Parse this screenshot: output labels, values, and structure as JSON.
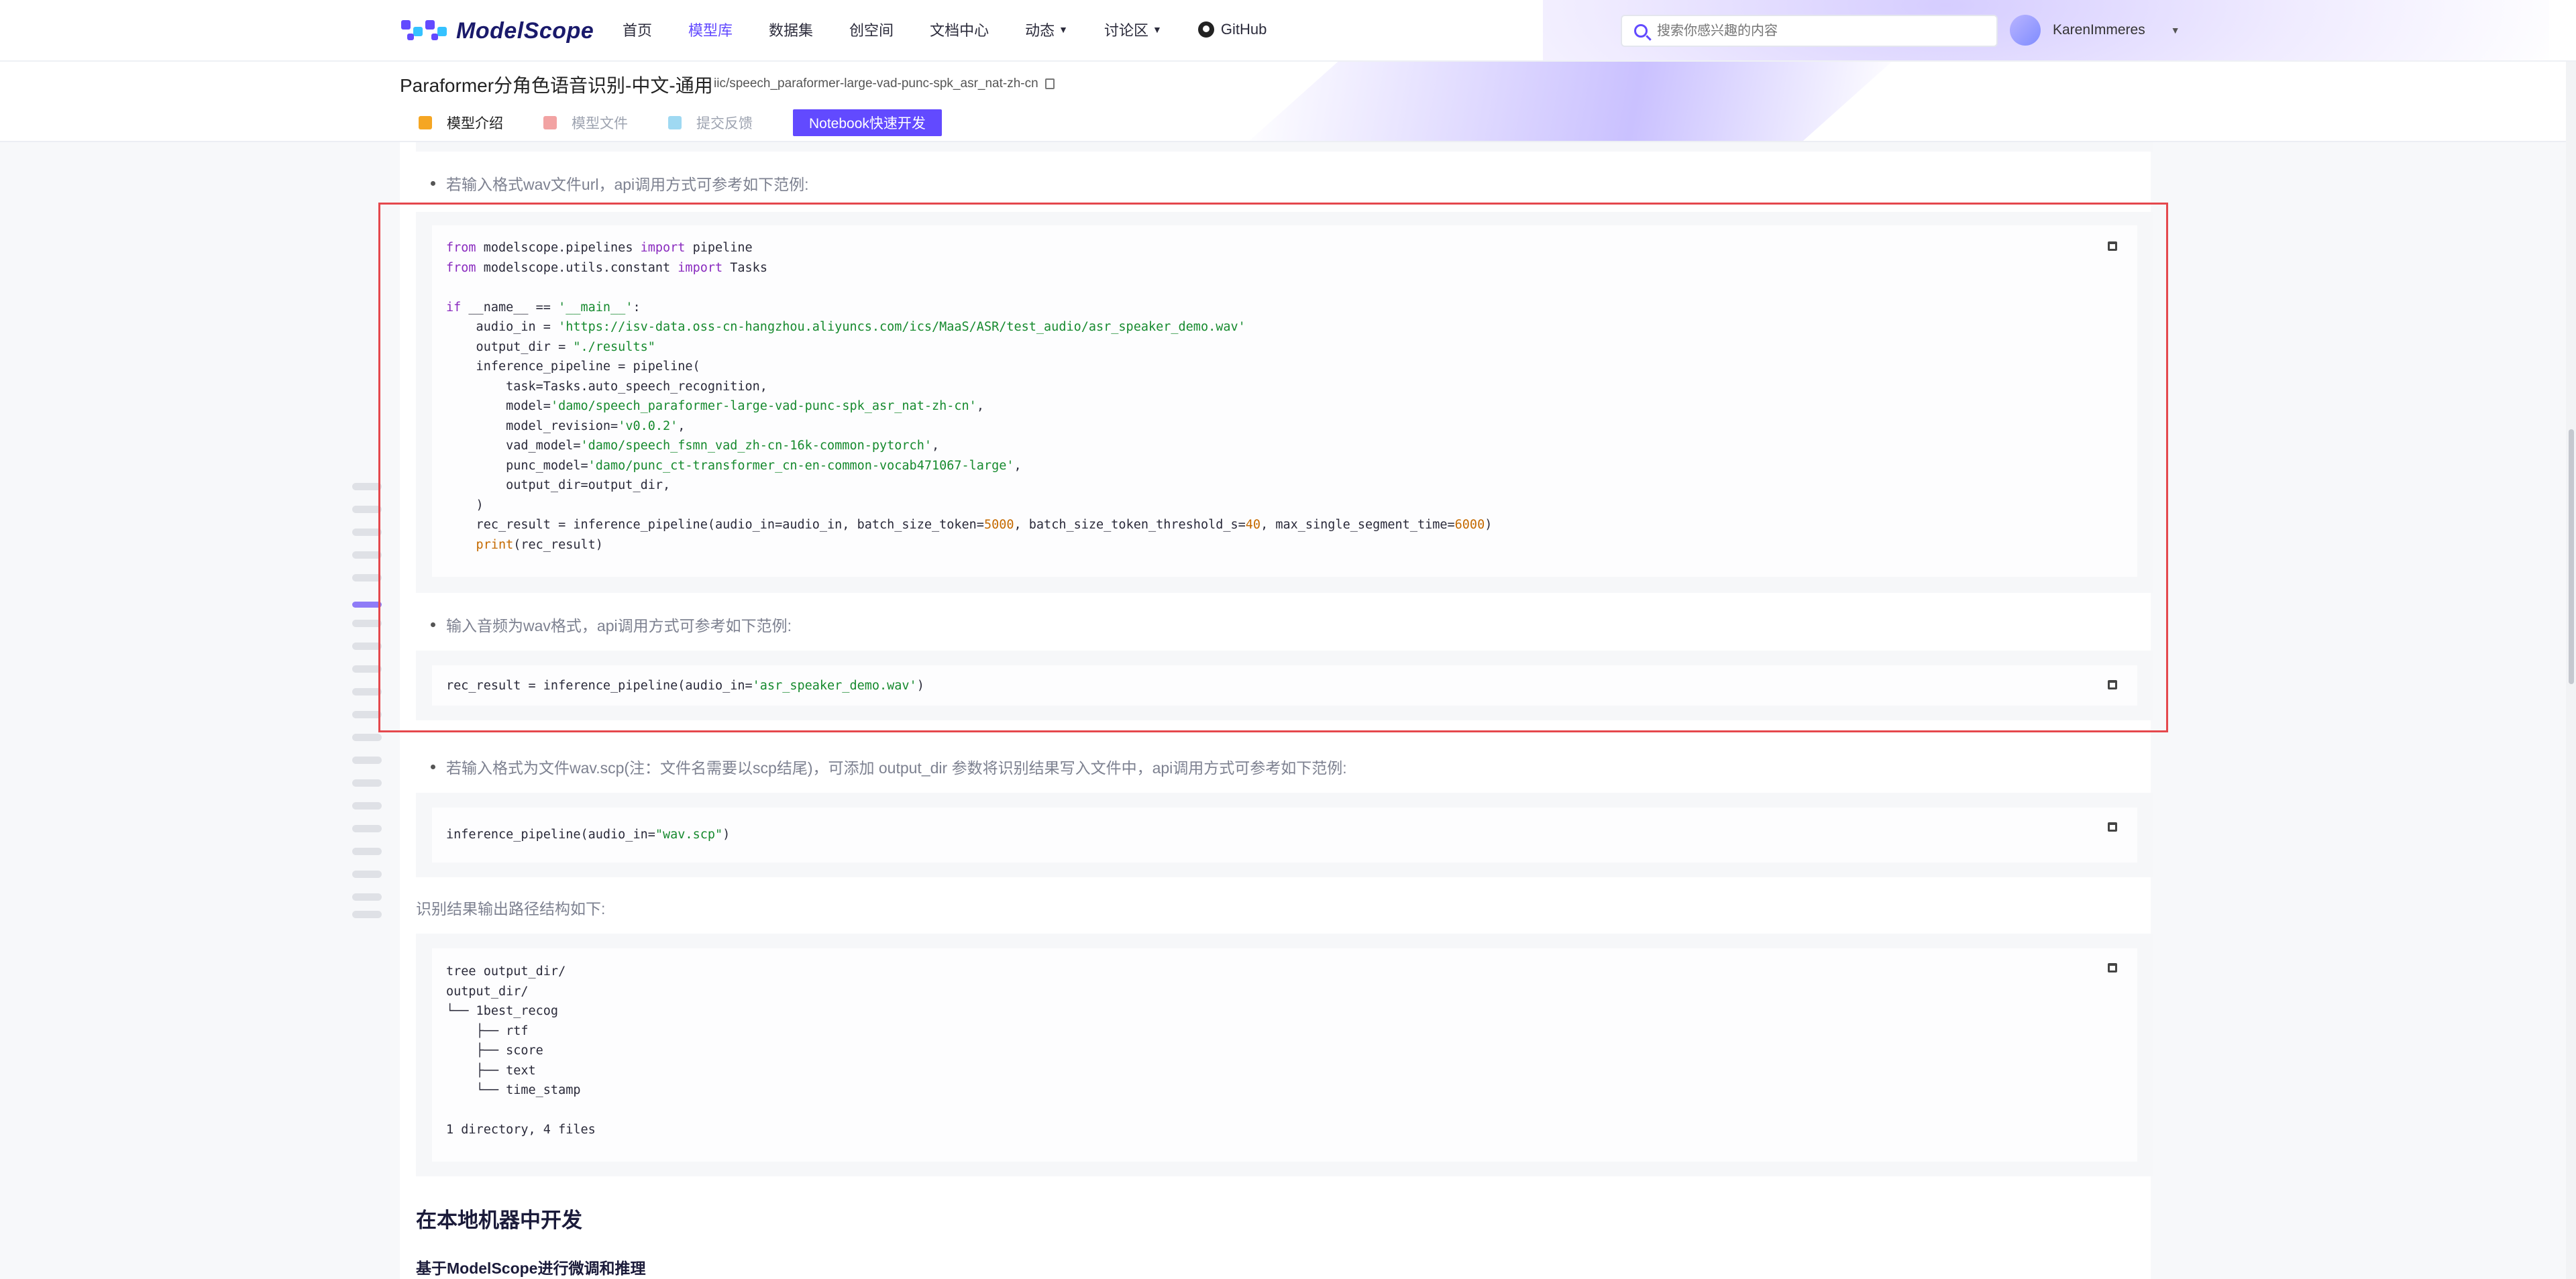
{
  "brand": {
    "name": "ModelScope"
  },
  "nav": {
    "items": [
      {
        "label": "首页",
        "active": false,
        "dropdown": false
      },
      {
        "label": "模型库",
        "active": true,
        "dropdown": false
      },
      {
        "label": "数据集",
        "active": false,
        "dropdown": false
      },
      {
        "label": "创空间",
        "active": false,
        "dropdown": false
      },
      {
        "label": "文档中心",
        "active": false,
        "dropdown": false
      },
      {
        "label": "动态",
        "active": false,
        "dropdown": true
      },
      {
        "label": "讨论区",
        "active": false,
        "dropdown": true
      }
    ],
    "github_label": "GitHub",
    "caret": "▼"
  },
  "search": {
    "placeholder": "搜索你感兴趣的内容"
  },
  "user": {
    "name": "KarenImmeres",
    "caret": "▼"
  },
  "model": {
    "title": "Paraformer分角色语音识别-中文-通用",
    "path": "iic/speech_paraformer-large-vad-punc-spk_asr_nat-zh-cn"
  },
  "tabs": [
    {
      "label": "模型介绍",
      "active": true,
      "icon": "cube-icon"
    },
    {
      "label": "模型文件",
      "active": false,
      "icon": "file-icon"
    },
    {
      "label": "提交反馈",
      "active": false,
      "icon": "feedback-icon"
    }
  ],
  "notebook_button": "Notebook快速开发",
  "content": {
    "bullet1": "若输入格式wav文件url，api调用方式可参考如下范例:",
    "code1": {
      "line1_kw1": "from",
      "line1_a": " modelscope.pipelines ",
      "line1_kw2": "import",
      "line1_b": " pipeline",
      "line2_kw1": "from",
      "line2_a": " modelscope.utils.constant ",
      "line2_kw2": "import",
      "line2_b": " Tasks",
      "line4_kw": "if",
      "line4_a": " __name__ == ",
      "line4_str": "'__main__'",
      "line4_b": ":",
      "line5_a": "    audio_in = ",
      "line5_str": "'https://isv-data.oss-cn-hangzhou.aliyuncs.com/ics/MaaS/ASR/test_audio/asr_speaker_demo.wav'",
      "line6_a": "    output_dir = ",
      "line6_str": "\"./results\"",
      "line7": "    inference_pipeline = pipeline(",
      "line8": "        task=Tasks.auto_speech_recognition,",
      "line9_a": "        model=",
      "line9_str": "'damo/speech_paraformer-large-vad-punc-spk_asr_nat-zh-cn'",
      "line9_b": ",",
      "line10_a": "        model_revision=",
      "line10_str": "'v0.0.2'",
      "line10_b": ",",
      "line11_a": "        vad_model=",
      "line11_str": "'damo/speech_fsmn_vad_zh-cn-16k-common-pytorch'",
      "line11_b": ",",
      "line12_a": "        punc_model=",
      "line12_str": "'damo/punc_ct-transformer_cn-en-common-vocab471067-large'",
      "line12_b": ",",
      "line13": "        output_dir=output_dir,",
      "line14": "    )",
      "line15_a": "    rec_result = inference_pipeline(audio_in=audio_in, batch_size_token=",
      "line15_n1": "5000",
      "line15_b": ", batch_size_token_threshold_s=",
      "line15_n2": "40",
      "line15_c": ", max_single_segment_time=",
      "line15_n3": "6000",
      "line15_d": ")",
      "line16_fn": "    print",
      "line16_a": "(rec_result)"
    },
    "bullet2": "输入音频为wav格式，api调用方式可参考如下范例:",
    "code2": {
      "a": "rec_result = inference_pipeline(audio_in=",
      "str": "'asr_speaker_demo.wav'",
      "b": ")"
    },
    "bullet3": "若输入格式为文件wav.scp(注：文件名需要以scp结尾)，可添加 output_dir 参数将识别结果写入文件中，api调用方式可参考如下范例:",
    "code3": {
      "a": "inference_pipeline(audio_in=",
      "str": "\"wav.scp\"",
      "b": ")"
    },
    "text4": "识别结果输出路径结构如下:",
    "code4": [
      "tree output_dir/",
      "output_dir/",
      "└── 1best_recog",
      "    ├── rtf",
      "    ├── score",
      "    ├── text",
      "    └── time_stamp",
      "",
      "1 directory, 4 files"
    ],
    "heading1": "在本地机器中开发",
    "heading2": "基于ModelScope进行微调和推理"
  },
  "colors": {
    "accent": "#624aff",
    "highlight_border": "#e5484d",
    "code_string": "#168a2e",
    "code_keyword": "#8a2bbf",
    "code_number": "#c56a00"
  }
}
